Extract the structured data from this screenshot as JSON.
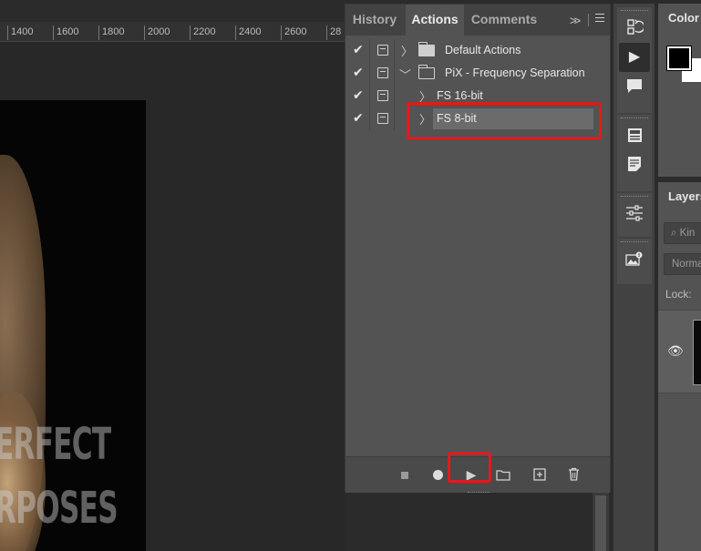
{
  "ruler": {
    "ticks": [
      "1400",
      "1600",
      "1800",
      "2000",
      "2200",
      "2400",
      "2600",
      "28"
    ]
  },
  "canvas": {
    "text_line1": "ERFECT",
    "text_line2": "RPOSES"
  },
  "actions_panel": {
    "tabs": [
      {
        "label": "History",
        "active": false
      },
      {
        "label": "Actions",
        "active": true
      },
      {
        "label": "Comments",
        "active": false
      }
    ],
    "more_icon": ">>",
    "menu_icon": "hamburger-icon",
    "rows": [
      {
        "label": "Default Actions",
        "kind": "set",
        "expanded": false,
        "checked": true
      },
      {
        "label": "PiX - Frequency Separation",
        "kind": "set",
        "expanded": true,
        "checked": true
      },
      {
        "label": "FS 16-bit",
        "kind": "action",
        "expanded": false,
        "checked": true
      },
      {
        "label": "FS 8-bit",
        "kind": "action",
        "expanded": false,
        "checked": true,
        "selected": true
      }
    ],
    "footer": {
      "buttons": [
        "stop-icon",
        "record-icon",
        "play-icon",
        "folder-icon",
        "new-action-icon",
        "trash-icon"
      ]
    },
    "highlight_color": "#e01b1b"
  },
  "toolstrip": {
    "icons": [
      "history-brush-icon",
      "play-icon",
      "comment-icon",
      "properties-icon",
      "notes-icon",
      "adjustments-icon",
      "image-badge-icon"
    ]
  },
  "color_panel": {
    "title": "Color"
  },
  "layers_panel": {
    "title": "Layers",
    "filter_placeholder": "Kin",
    "blend_mode": "Norma",
    "lock_label": "Lock:"
  }
}
